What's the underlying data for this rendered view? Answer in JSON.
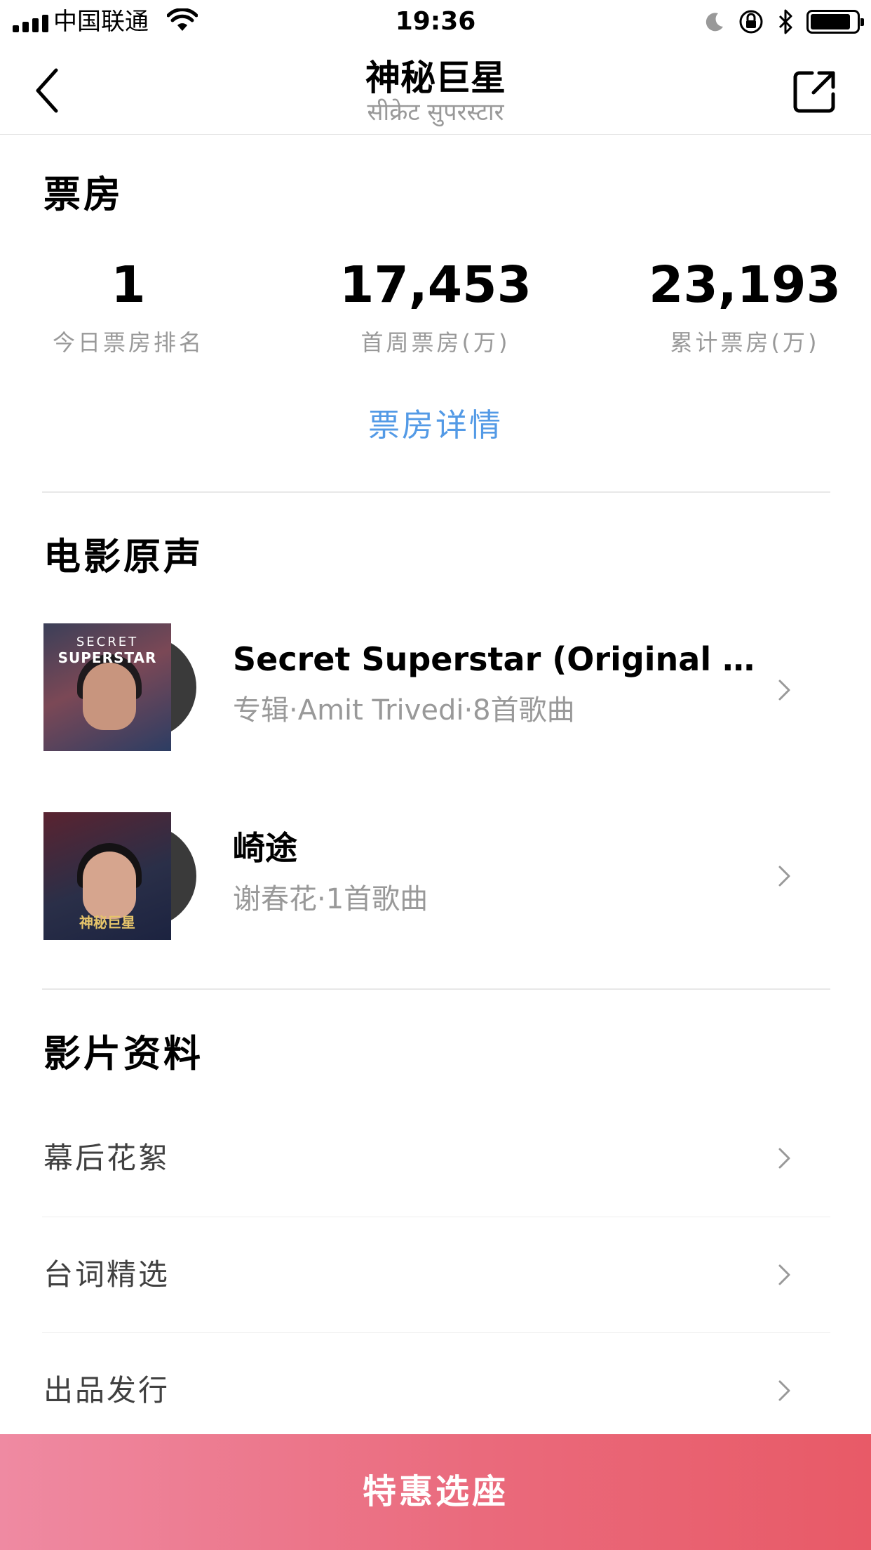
{
  "status_bar": {
    "carrier": "中国联通",
    "time": "19:36"
  },
  "nav": {
    "title": "神秘巨星",
    "subtitle": "सीक्रेट सुपरस्टार",
    "back_icon": "chevron-left-icon",
    "share_icon": "share-icon"
  },
  "box_office": {
    "title": "票房",
    "stats": [
      {
        "value": "1",
        "label": "今日票房排名"
      },
      {
        "value": "17,453",
        "label": "首周票房(万)"
      },
      {
        "value": "23,193",
        "label": "累计票房(万)"
      }
    ],
    "detail_link": "票房详情"
  },
  "soundtrack": {
    "title": "电影原声",
    "albums": [
      {
        "title": "Secret Superstar (Original Motio...",
        "subtitle": "专辑·Amit Trivedi·8首歌曲",
        "cover_text_top": "SECRET",
        "cover_text_main": "SUPERSTAR"
      },
      {
        "title": "崎途",
        "subtitle": "谢春花·1首歌曲",
        "cover_logo": "神秘巨星"
      }
    ]
  },
  "film_info": {
    "title": "影片资料",
    "items": [
      {
        "label": "幕后花絮"
      },
      {
        "label": "台词精选"
      },
      {
        "label": "出品发行"
      }
    ]
  },
  "buy_button": {
    "label": "特惠选座"
  },
  "colors": {
    "link": "#539ae6",
    "secondary_text": "#999999",
    "row_text": "#404040",
    "button_gradient_start": "#ef8aa2",
    "button_gradient_end": "#e85a67"
  }
}
